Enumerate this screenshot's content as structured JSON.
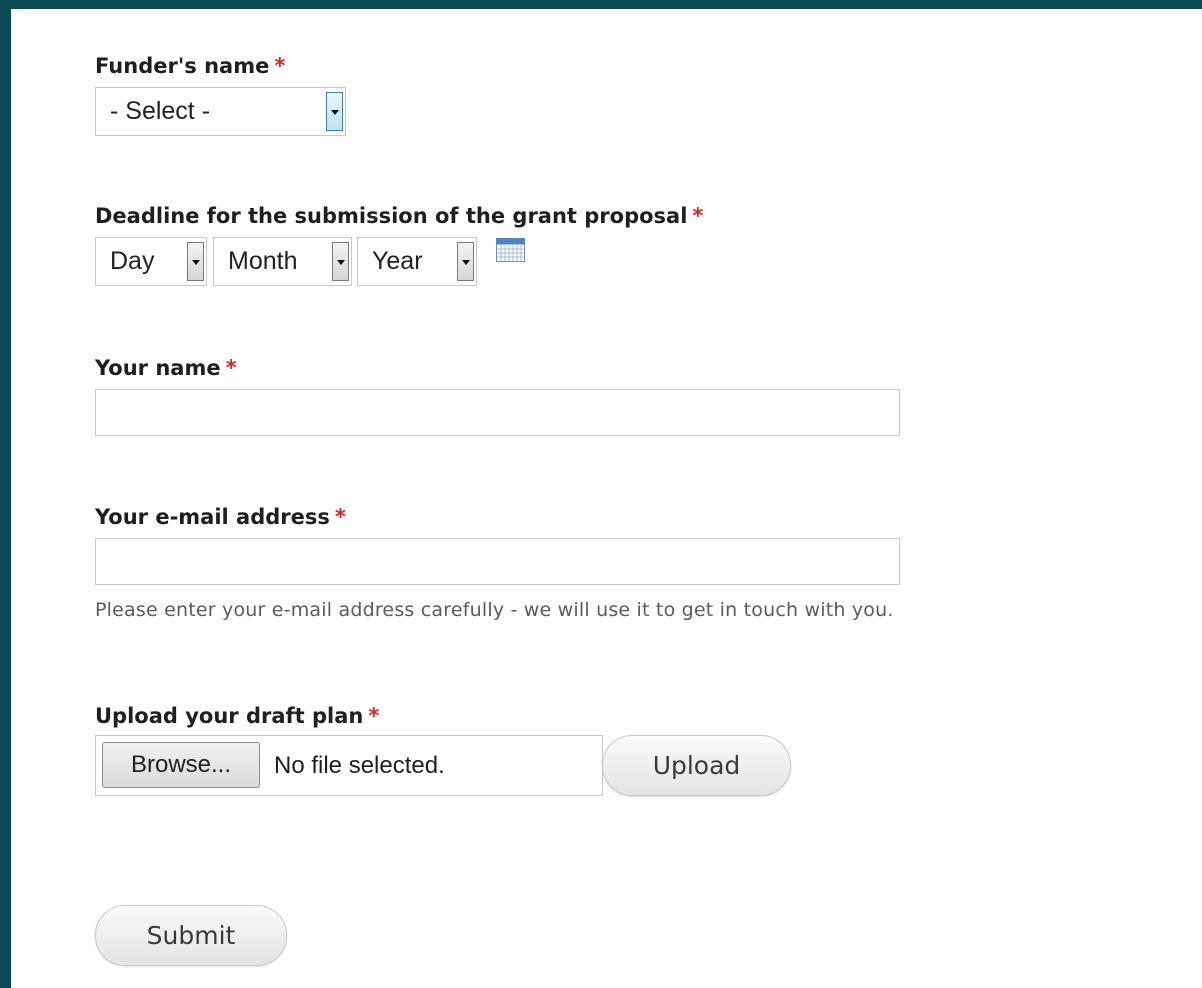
{
  "form": {
    "funder": {
      "label": "Funder's name",
      "required_mark": "*",
      "selected": "- Select -"
    },
    "deadline": {
      "label": "Deadline for the submission of the grant proposal",
      "required_mark": "*",
      "day": "Day",
      "month": "Month",
      "year": "Year",
      "calendar_icon": "calendar-icon"
    },
    "name": {
      "label": "Your name",
      "required_mark": "*",
      "value": ""
    },
    "email": {
      "label": "Your e-mail address",
      "required_mark": "*",
      "value": "",
      "help": "Please enter your e-mail address carefully - we will use it to get in touch with you."
    },
    "upload": {
      "label": "Upload your draft plan",
      "required_mark": "*",
      "browse_label": "Browse...",
      "file_status": "No file selected.",
      "upload_label": "Upload"
    },
    "submit_label": "Submit"
  },
  "colors": {
    "page_background": "#0a4a55",
    "panel_background": "#ffffff",
    "required_marker": "#e2231a",
    "help_text": "#5b5b5b"
  }
}
